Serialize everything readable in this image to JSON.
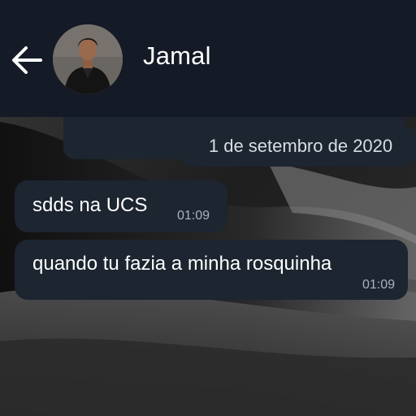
{
  "header": {
    "contact_name": "Jamal",
    "back_icon": "arrow-left-icon",
    "avatar_icon": "contact-avatar"
  },
  "chat": {
    "date_chip": "1 de setembro de 2020",
    "messages": [
      {
        "text": "sdds na UCS",
        "time": "01:09"
      },
      {
        "text": "quando tu fazia a minha rosquinha",
        "time": "01:09"
      }
    ]
  },
  "colors": {
    "header_bg": "#141b26",
    "bubble_bg": "#1c2530",
    "text": "#ffffff",
    "time_text": "#aab3bd"
  }
}
